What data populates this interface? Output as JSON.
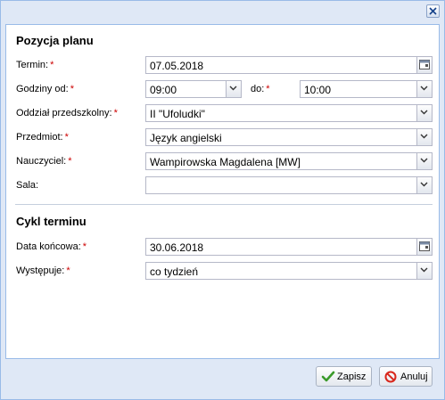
{
  "window": {
    "close_icon": "close-icon"
  },
  "section_plan": {
    "title": "Pozycja planu",
    "termin": {
      "label": "Termin:",
      "value": "07.05.2018"
    },
    "godziny_od": {
      "label": "Godziny od:",
      "value": "09:00"
    },
    "do": {
      "label": "do:",
      "value": "10:00"
    },
    "oddzial": {
      "label": "Oddział przedszkolny:",
      "value": "II \"Ufoludki\""
    },
    "przedmiot": {
      "label": "Przedmiot:",
      "value": "Język angielski"
    },
    "nauczyciel": {
      "label": "Nauczyciel:",
      "value": "Wampirowska Magdalena [MW]"
    },
    "sala": {
      "label": "Sala:",
      "value": ""
    }
  },
  "section_cycle": {
    "title": "Cykl terminu",
    "data_koncowa": {
      "label": "Data końcowa:",
      "value": "30.06.2018"
    },
    "wystepuje": {
      "label": "Występuje:",
      "value": "co tydzień"
    }
  },
  "required_marker": "*",
  "buttons": {
    "save": {
      "label": "Zapisz",
      "icon": "checkmark-icon"
    },
    "cancel": {
      "label": "Anuluj",
      "icon": "cancel-icon"
    }
  },
  "colors": {
    "required": "#cc0000",
    "frame": "#dfe8f6",
    "border": "#99bbe8"
  }
}
